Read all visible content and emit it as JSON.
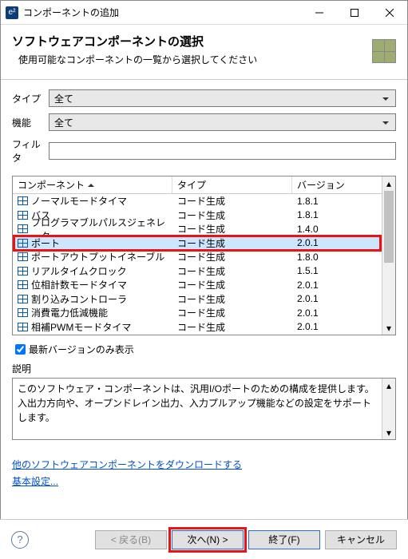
{
  "title": "コンポーネントの追加",
  "t_icon": "e²",
  "header": {
    "title": "ソフトウェアコンポーネントの選択",
    "subtitle": "使用可能なコンポーネントの一覧から選択してください"
  },
  "filters": {
    "type_label": "タイプ",
    "type_value": "全て",
    "func_label": "機能",
    "func_value": "全て",
    "filter_label": "フィルタ",
    "filter_value": ""
  },
  "columns": {
    "component": "コンポーネント",
    "type": "タイプ",
    "version": "バージョン"
  },
  "rows": [
    {
      "c": "ノーマルモードタイマ",
      "t": "コード生成",
      "v": "1.8.1",
      "sel": false,
      "hl": false
    },
    {
      "c": "バス",
      "t": "コード生成",
      "v": "1.8.1",
      "sel": false,
      "hl": false
    },
    {
      "c": "プログラマブルパルスジェネレータ",
      "t": "コード生成",
      "v": "1.4.0",
      "sel": false,
      "hl": false
    },
    {
      "c": "ポート",
      "t": "コード生成",
      "v": "2.0.1",
      "sel": true,
      "hl": true
    },
    {
      "c": "ポートアウトプットイネーブル",
      "t": "コード生成",
      "v": "1.8.0",
      "sel": false,
      "hl": false
    },
    {
      "c": "リアルタイムクロック",
      "t": "コード生成",
      "v": "1.5.1",
      "sel": false,
      "hl": false
    },
    {
      "c": "位相計数モードタイマ",
      "t": "コード生成",
      "v": "2.0.1",
      "sel": false,
      "hl": false
    },
    {
      "c": "割り込みコントローラ",
      "t": "コード生成",
      "v": "2.0.1",
      "sel": false,
      "hl": false
    },
    {
      "c": "消費電力低減機能",
      "t": "コード生成",
      "v": "2.0.1",
      "sel": false,
      "hl": false
    },
    {
      "c": "相補PWMモードタイマ",
      "t": "コード生成",
      "v": "2.0.1",
      "sel": false,
      "hl": false
    }
  ],
  "chk_label": "最新バージョンのみ表示",
  "desc_label": "説明",
  "description": "このソフトウェア・コンポーネントは、汎用I/Oポートのための構成を提供します。入出力方向や、オープンドレイン出力、入力プルアップ機能などの設定をサポートします。",
  "links": {
    "download": "他のソフトウェアコンポーネントをダウンロードする",
    "basic": "基本設定..."
  },
  "buttons": {
    "back": "< 戻る(B)",
    "next": "次へ(N) >",
    "finish": "終了(F)",
    "cancel": "キャンセル"
  }
}
